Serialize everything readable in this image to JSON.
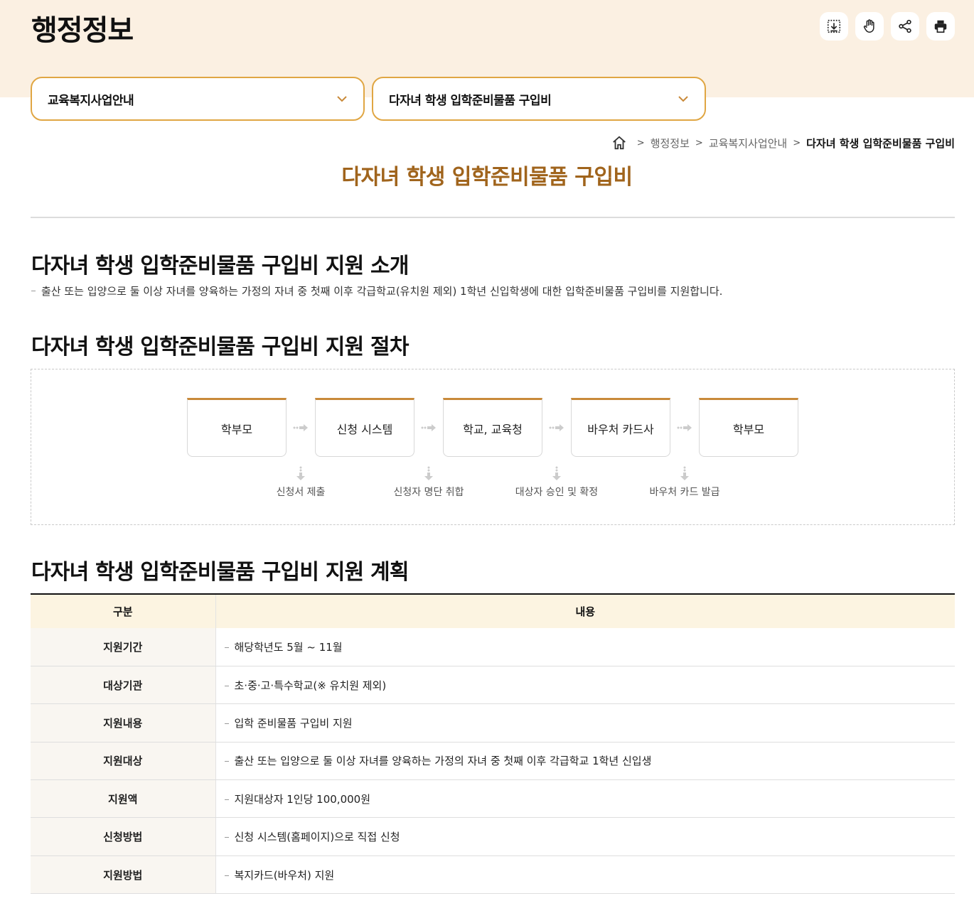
{
  "header": {
    "title": "행정정보",
    "tools": [
      {
        "icon": "download-icon"
      },
      {
        "icon": "hand-icon"
      },
      {
        "icon": "share-icon"
      },
      {
        "icon": "print-icon"
      }
    ]
  },
  "selects": {
    "category": "교육복지사업안내",
    "page": "다자녀 학생 입학준비물품 구입비"
  },
  "breadcrumb": {
    "home_icon": "home-icon",
    "items": [
      "행정정보",
      "교육복지사업안내",
      "다자녀 학생 입학준비물품 구입비"
    ]
  },
  "content_title": "다자녀 학생 입학준비물품 구입비",
  "intro": {
    "title": "다자녀 학생 입학준비물품 구입비 지원 소개",
    "text": "출산 또는 입양으로 둘 이상 자녀를 양육하는 가정의 자녀 중 첫째 이후 각급학교(유치원 제외) 1학년 신입학생에 대한 입학준비물품 구입비를 지원합니다."
  },
  "procedure": {
    "title": "다자녀 학생 입학준비물품 구입비 지원 절차",
    "steps": [
      "학부모",
      "신청 시스템",
      "학교, 교육청",
      "바우처 카드사",
      "학부모"
    ],
    "notes": [
      "신청서 제출",
      "신청자 명단 취합",
      "대상자 승인 및 확정",
      "바우처 카드 발급"
    ]
  },
  "plan": {
    "title": "다자녀 학생 입학준비물품 구입비 지원 계획",
    "headers": [
      "구분",
      "내용"
    ],
    "rows": [
      {
        "label": "지원기간",
        "value": "해당학년도 5월 ~ 11월"
      },
      {
        "label": "대상기관",
        "value": "초·중·고·특수학교(※ 유치원 제외)"
      },
      {
        "label": "지원내용",
        "value": "입학 준비물품 구입비 지원"
      },
      {
        "label": "지원대상",
        "value": "출산 또는 입양으로 둘 이상 자녀를 양육하는 가정의 자녀 중 첫째 이후 각급학교 1학년 신입생"
      },
      {
        "label": "지원액",
        "value": "지원대상자 1인당 100,000원"
      },
      {
        "label": "신청방법",
        "value": "신청 시스템(홈페이지)으로 직접 신청"
      },
      {
        "label": "지원방법",
        "value": "복지카드(바우처) 지원"
      }
    ]
  },
  "colors": {
    "top_band": "#fbf0e2",
    "accent": "#e0a643",
    "title_brown": "#a0641c",
    "table_header": "#fcf4e1"
  }
}
